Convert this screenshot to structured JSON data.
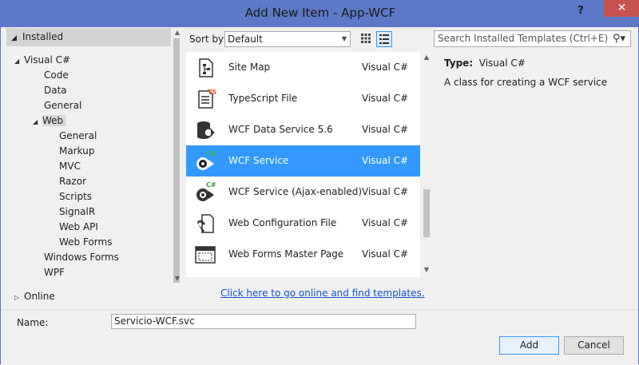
{
  "window": {
    "title": "Add New Item - App-WCF",
    "help_glyph": "?",
    "close_glyph": "✕"
  },
  "tree": {
    "installed": "Installed",
    "items": [
      {
        "label": "Visual C#"
      },
      {
        "label": "Code"
      },
      {
        "label": "Data"
      },
      {
        "label": "General"
      },
      {
        "label": "Web"
      },
      {
        "label": "General"
      },
      {
        "label": "Markup"
      },
      {
        "label": "MVC"
      },
      {
        "label": "Razor"
      },
      {
        "label": "Scripts"
      },
      {
        "label": "SignalR"
      },
      {
        "label": "Web API"
      },
      {
        "label": "Web Forms"
      },
      {
        "label": "Windows Forms"
      },
      {
        "label": "WPF"
      }
    ],
    "online": "Online"
  },
  "sort": {
    "label": "Sort by:",
    "value": "Default"
  },
  "search": {
    "placeholder": "Search Installed Templates (Ctrl+E)"
  },
  "templates": [
    {
      "name": "Site Map",
      "lang": "Visual C#",
      "icon": "site-map-icon"
    },
    {
      "name": "TypeScript File",
      "lang": "Visual C#",
      "icon": "typescript-file-icon"
    },
    {
      "name": "WCF Data Service 5.6",
      "lang": "Visual C#",
      "icon": "wcf-data-service-icon"
    },
    {
      "name": "WCF Service",
      "lang": "Visual C#",
      "icon": "wcf-service-icon",
      "selected": true
    },
    {
      "name": "WCF Service (Ajax-enabled)",
      "lang": "Visual C#",
      "icon": "wcf-ajax-service-icon"
    },
    {
      "name": "Web Configuration File",
      "lang": "Visual C#",
      "icon": "web-config-icon"
    },
    {
      "name": "Web Forms Master Page",
      "lang": "Visual C#",
      "icon": "master-page-icon"
    }
  ],
  "online_link": "Click here to go online and find templates.",
  "details": {
    "type_label": "Type:",
    "type_value": "Visual C#",
    "description": "A class for creating a WCF service"
  },
  "name_field": {
    "label": "Name:",
    "value": "Servicio-WCF.svc"
  },
  "buttons": {
    "add": "Add",
    "cancel": "Cancel"
  },
  "colors": {
    "titlebar": "#5e78c8",
    "selection": "#3399ff",
    "close": "#c75050",
    "link": "#1155cc"
  }
}
